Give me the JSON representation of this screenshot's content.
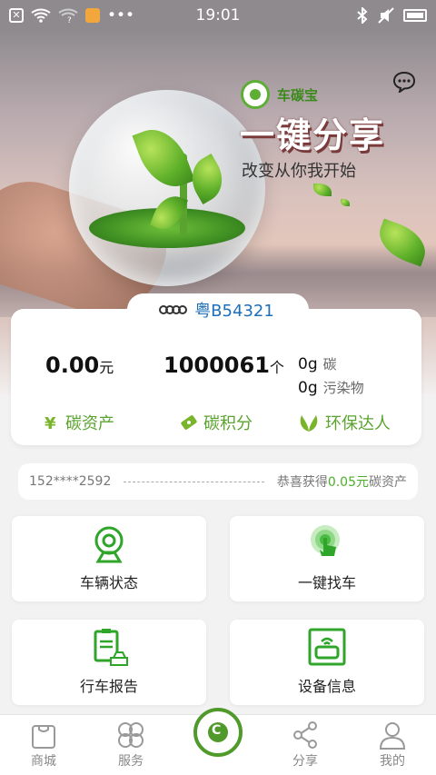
{
  "status_bar": {
    "time": "19:01"
  },
  "hero": {
    "brand": "车碳宝",
    "slogan": "一键分享",
    "sub_slogan": "改变从你我开始"
  },
  "vehicle": {
    "plate": "粤B54321"
  },
  "summary": {
    "money_value": "0.00",
    "money_unit": "元",
    "points_value": "1000061",
    "points_unit": "个",
    "carbon_value": "0g",
    "carbon_label": "碳",
    "pollutant_value": "0g",
    "pollutant_label": "污染物",
    "link_assets": "碳资产",
    "link_points": "碳积分",
    "link_eco": "环保达人"
  },
  "ticker": {
    "phone": "152****2592",
    "prefix": "恭喜获得",
    "amount": "0.05元",
    "suffix": "碳资产"
  },
  "tiles": {
    "vehicle_status": "车辆状态",
    "find_car": "一键找车",
    "trip_report": "行车报告",
    "device_info": "设备信息"
  },
  "nav": {
    "shop": "商城",
    "service": "服务",
    "share": "分享",
    "mine": "我的"
  },
  "colors": {
    "accent_green": "#5aa32e",
    "plate_blue": "#1d6fb8"
  }
}
